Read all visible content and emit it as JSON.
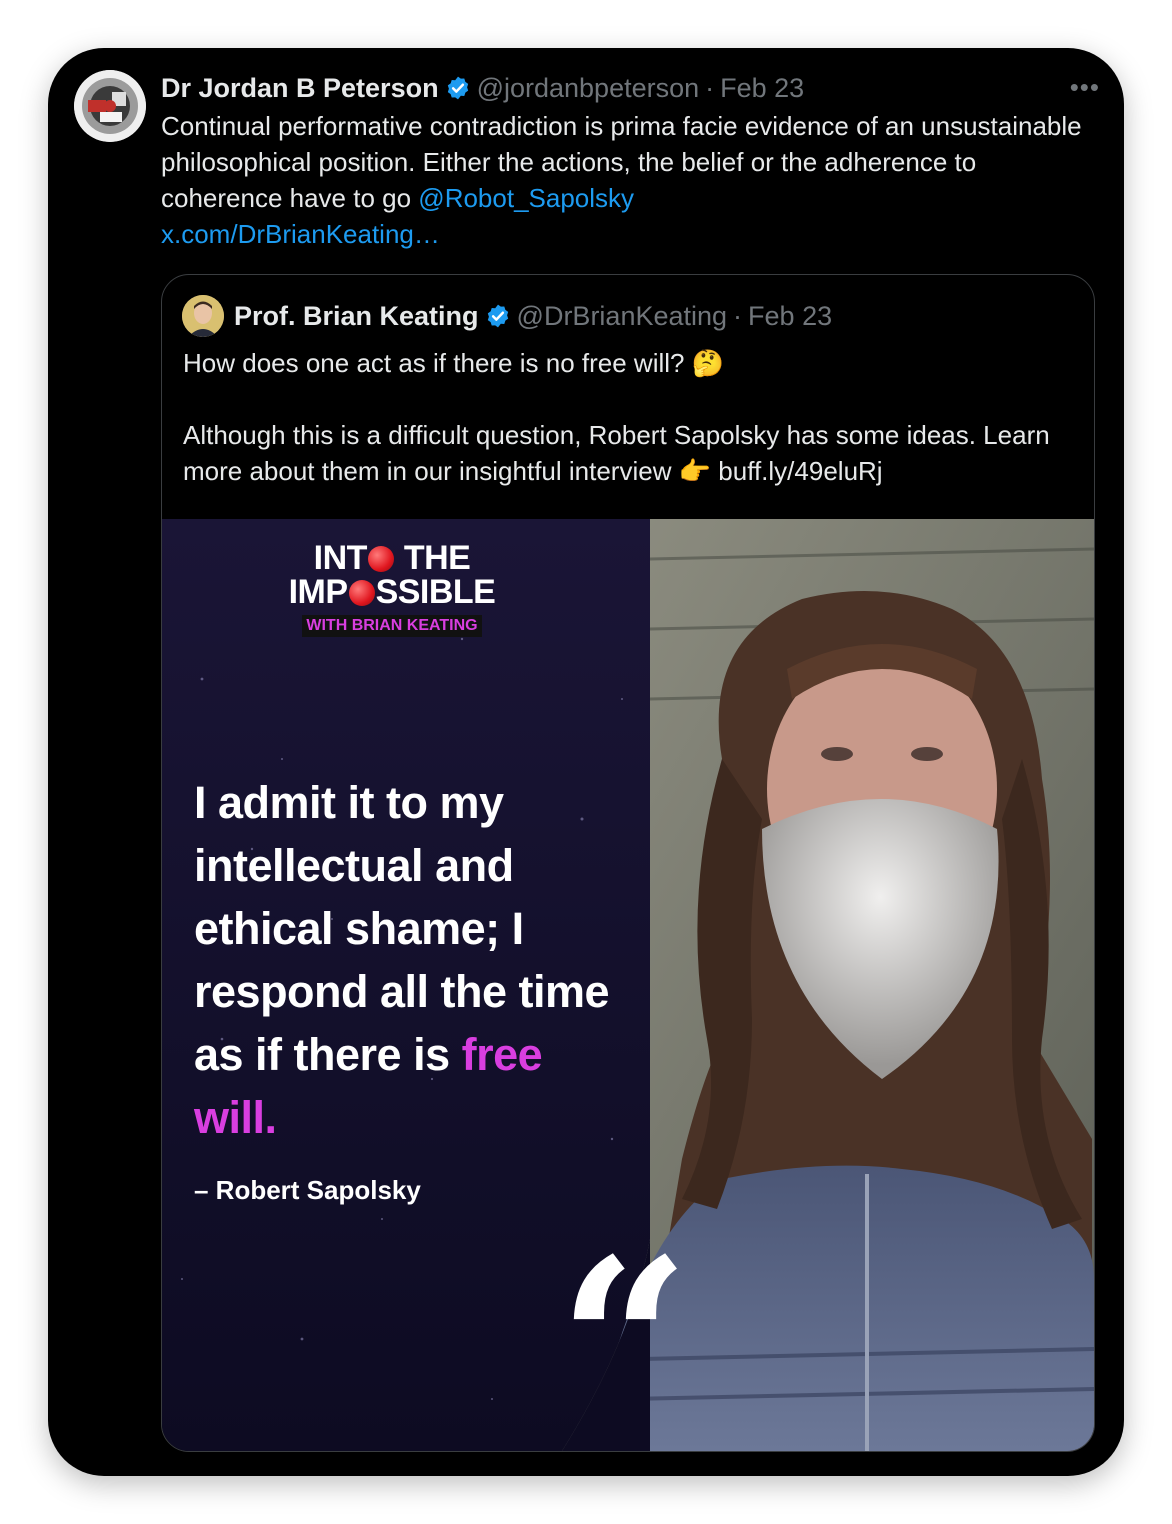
{
  "tweet": {
    "author_name": "Dr Jordan B Peterson",
    "handle": "@jordanbpeterson",
    "separator": "·",
    "date": "Feb 23",
    "more_label": "•••",
    "text": "Continual performative contradiction is prima facie evidence of an unsustainable philosophical position. Either the actions, the belief or the adherence to coherence have to go ",
    "mention": "@Robot_Sapolsky",
    "link": "x.com/DrBrianKeating…"
  },
  "quoted": {
    "author_name": "Prof. Brian Keating",
    "handle": "@DrBrianKeating",
    "separator": "·",
    "date": "Feb 23",
    "line1": "How does one act as if there is no free will? 🤔",
    "line2": "Although this is a difficult question, Robert Sapolsky has some ideas. Learn more about them in our insightful interview 👉 buff.ly/49eluRj",
    "media": {
      "logo_line1_a": "INT",
      "logo_line1_b": " THE",
      "logo_line2_a": "IMP",
      "logo_line2_b": "SSIBLE",
      "logo_sub": "WITH BRIAN KEATING",
      "quote_main": "I admit it to my intellectual and ethical shame; I respond all the time as if there is ",
      "quote_highlight": "free will.",
      "attribution": "– Robert Sapolsky",
      "quote_mark": "“",
      "highlight_color": "#d93ee0"
    }
  },
  "colors": {
    "background": "#000000",
    "text": "#e7e9ea",
    "muted": "#71767b",
    "link": "#1d9bf0",
    "verified": "#1d9bf0"
  }
}
